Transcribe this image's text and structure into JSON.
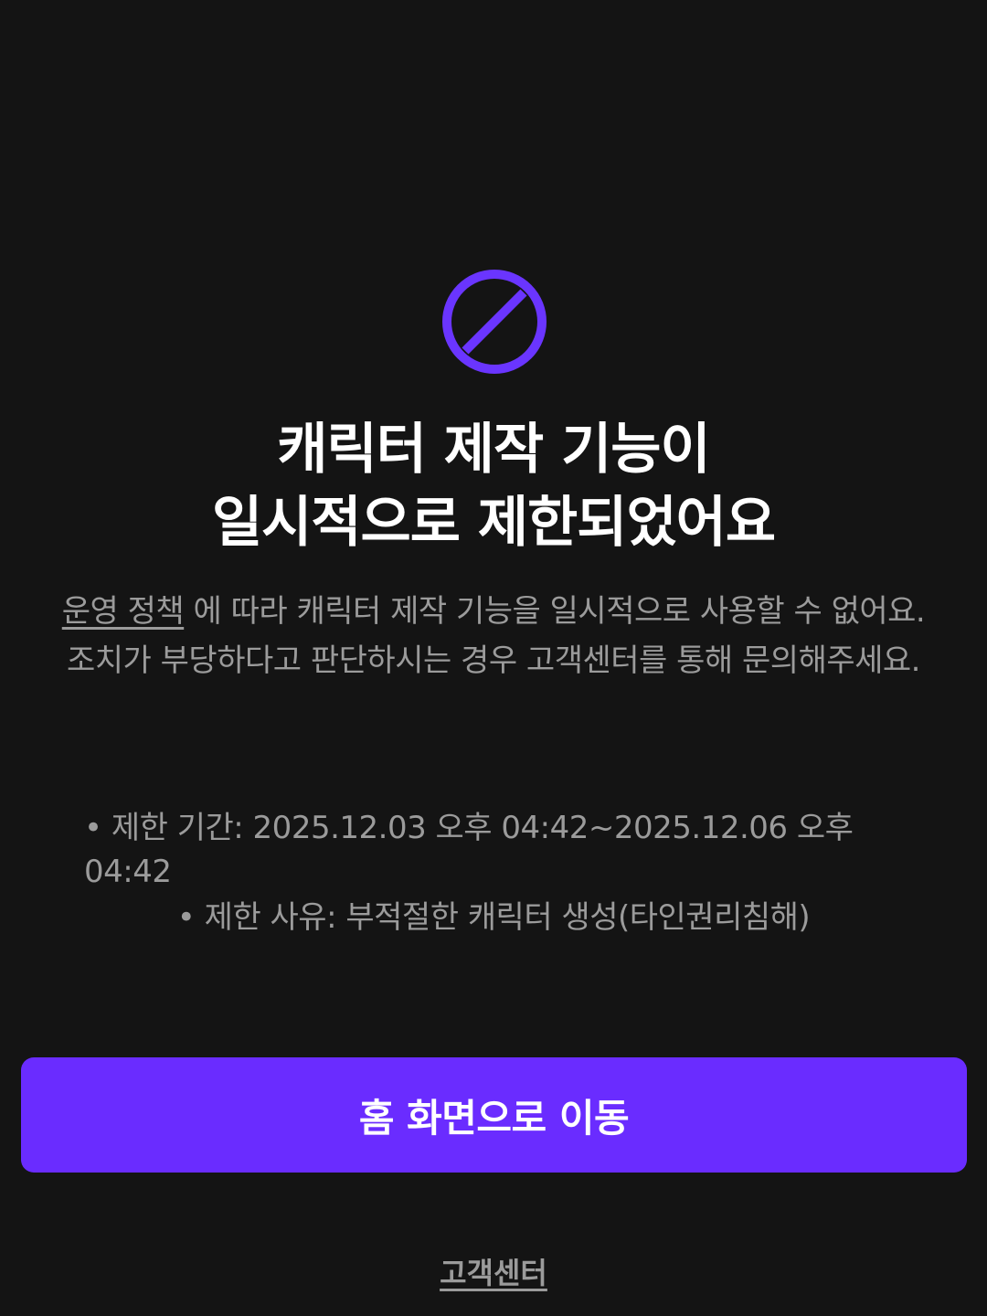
{
  "colors": {
    "background": "#141414",
    "accent": "#6a2cff",
    "icon": "#6a35ff",
    "title": "#ffffff",
    "body_text": "#9b9b9b"
  },
  "icon": {
    "name": "prohibited-icon"
  },
  "title": {
    "line1": "캐릭터 제작 기능이",
    "line2": "일시적으로 제한되었어요"
  },
  "description": {
    "policy_link": "운영 정책",
    "text_after_link": " 에 따라 캐릭터 제작 기능을 일시적으로 사용할 수 없어요.",
    "paragraph2": "조치가 부당하다고 판단하시는 경우 고객센터를 통해 문의해주세요."
  },
  "details": {
    "period": "• 제한 기간: 2025.12.03 오후 04:42~2025.12.06 오후 04:42",
    "reason": "• 제한 사유: 부적절한 캐릭터 생성(타인권리침해)"
  },
  "home_button": {
    "label": "홈 화면으로 이동"
  },
  "customer_center": {
    "label": "고객센터"
  }
}
